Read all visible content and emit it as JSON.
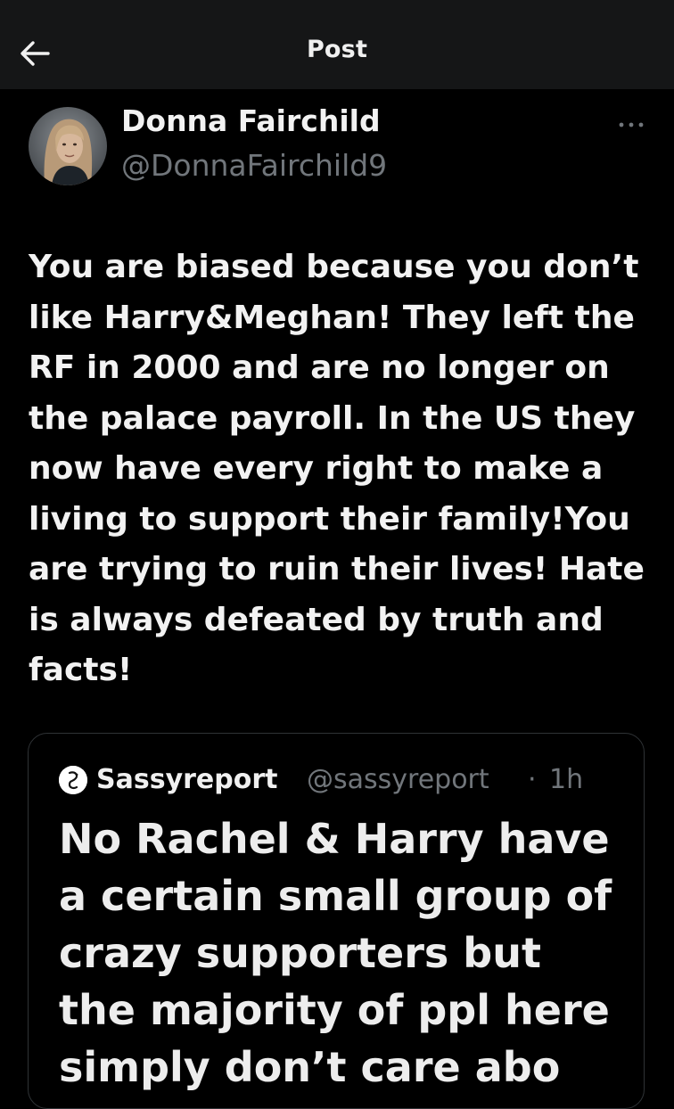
{
  "header": {
    "title": "Post",
    "back_icon": "arrow-left-icon"
  },
  "post": {
    "author": {
      "display_name": "Donna Fairchild",
      "handle": "@DonnaFairchild9",
      "avatar_icon": "profile-photo"
    },
    "more_icon": "more-horizontal-icon",
    "text_lines": [
      "You are biased because you don’t",
      "like Harry&Meghan! They left the",
      "RF in 2000 and are no longer on",
      "the palace payroll. In the US they",
      "now have every right to make a",
      "living to support their family!You",
      "are trying to ruin their lives! Hate",
      "is always defeated by truth and",
      "facts!"
    ]
  },
  "quoted_post": {
    "author": {
      "display_name": "Sassyreport",
      "handle": "@sassyreport",
      "separator": "·",
      "time": "1h",
      "avatar_icon": "sassyreport-logo"
    },
    "text_lines": [
      "No Rachel & Harry have",
      "a certain small group of",
      "crazy supporters but",
      "the majority of ppl here",
      "simply don’t care abo"
    ]
  },
  "colors": {
    "background": "#000000",
    "header_bg": "#151617",
    "primary_text": "#e7e9ea",
    "secondary_text": "#71767b",
    "border": "#2f3336"
  }
}
